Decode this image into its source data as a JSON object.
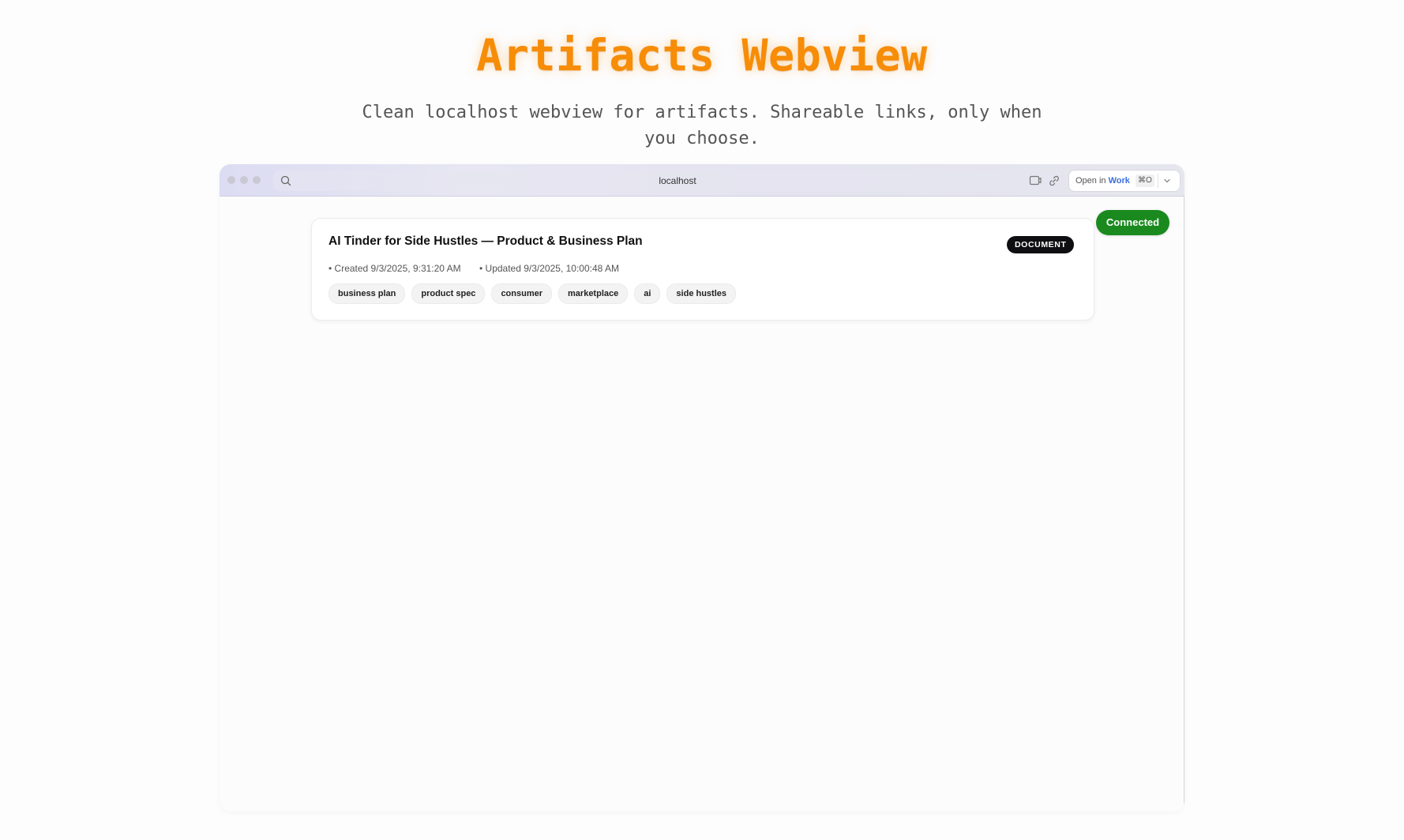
{
  "hero": {
    "title": "Artifacts Webview",
    "subtitle": "Clean localhost webview for artifacts. Shareable links, only when you choose."
  },
  "browser": {
    "address": "localhost",
    "open_in_prefix": "Open in ",
    "open_in_app": "Work",
    "open_in_shortcut": "⌘O"
  },
  "status": {
    "connected_label": "Connected",
    "connected_color": "#1a8a1e"
  },
  "artifact": {
    "title": "AI Tinder for Side Hustles — Product & Business Plan",
    "type": "DOCUMENT",
    "created": "• Created 9/3/2025, 9:31:20 AM",
    "updated": "• Updated 9/3/2025, 10:00:48 AM",
    "tags": [
      "business plan",
      "product spec",
      "consumer",
      "marketplace",
      "ai",
      "side hustles"
    ]
  },
  "colors": {
    "accent_title": "#f78c06",
    "link_blue": "#3b6fe0"
  },
  "icons": [
    "search-icon",
    "cast-icon",
    "link-icon",
    "chevron-down-icon"
  ]
}
